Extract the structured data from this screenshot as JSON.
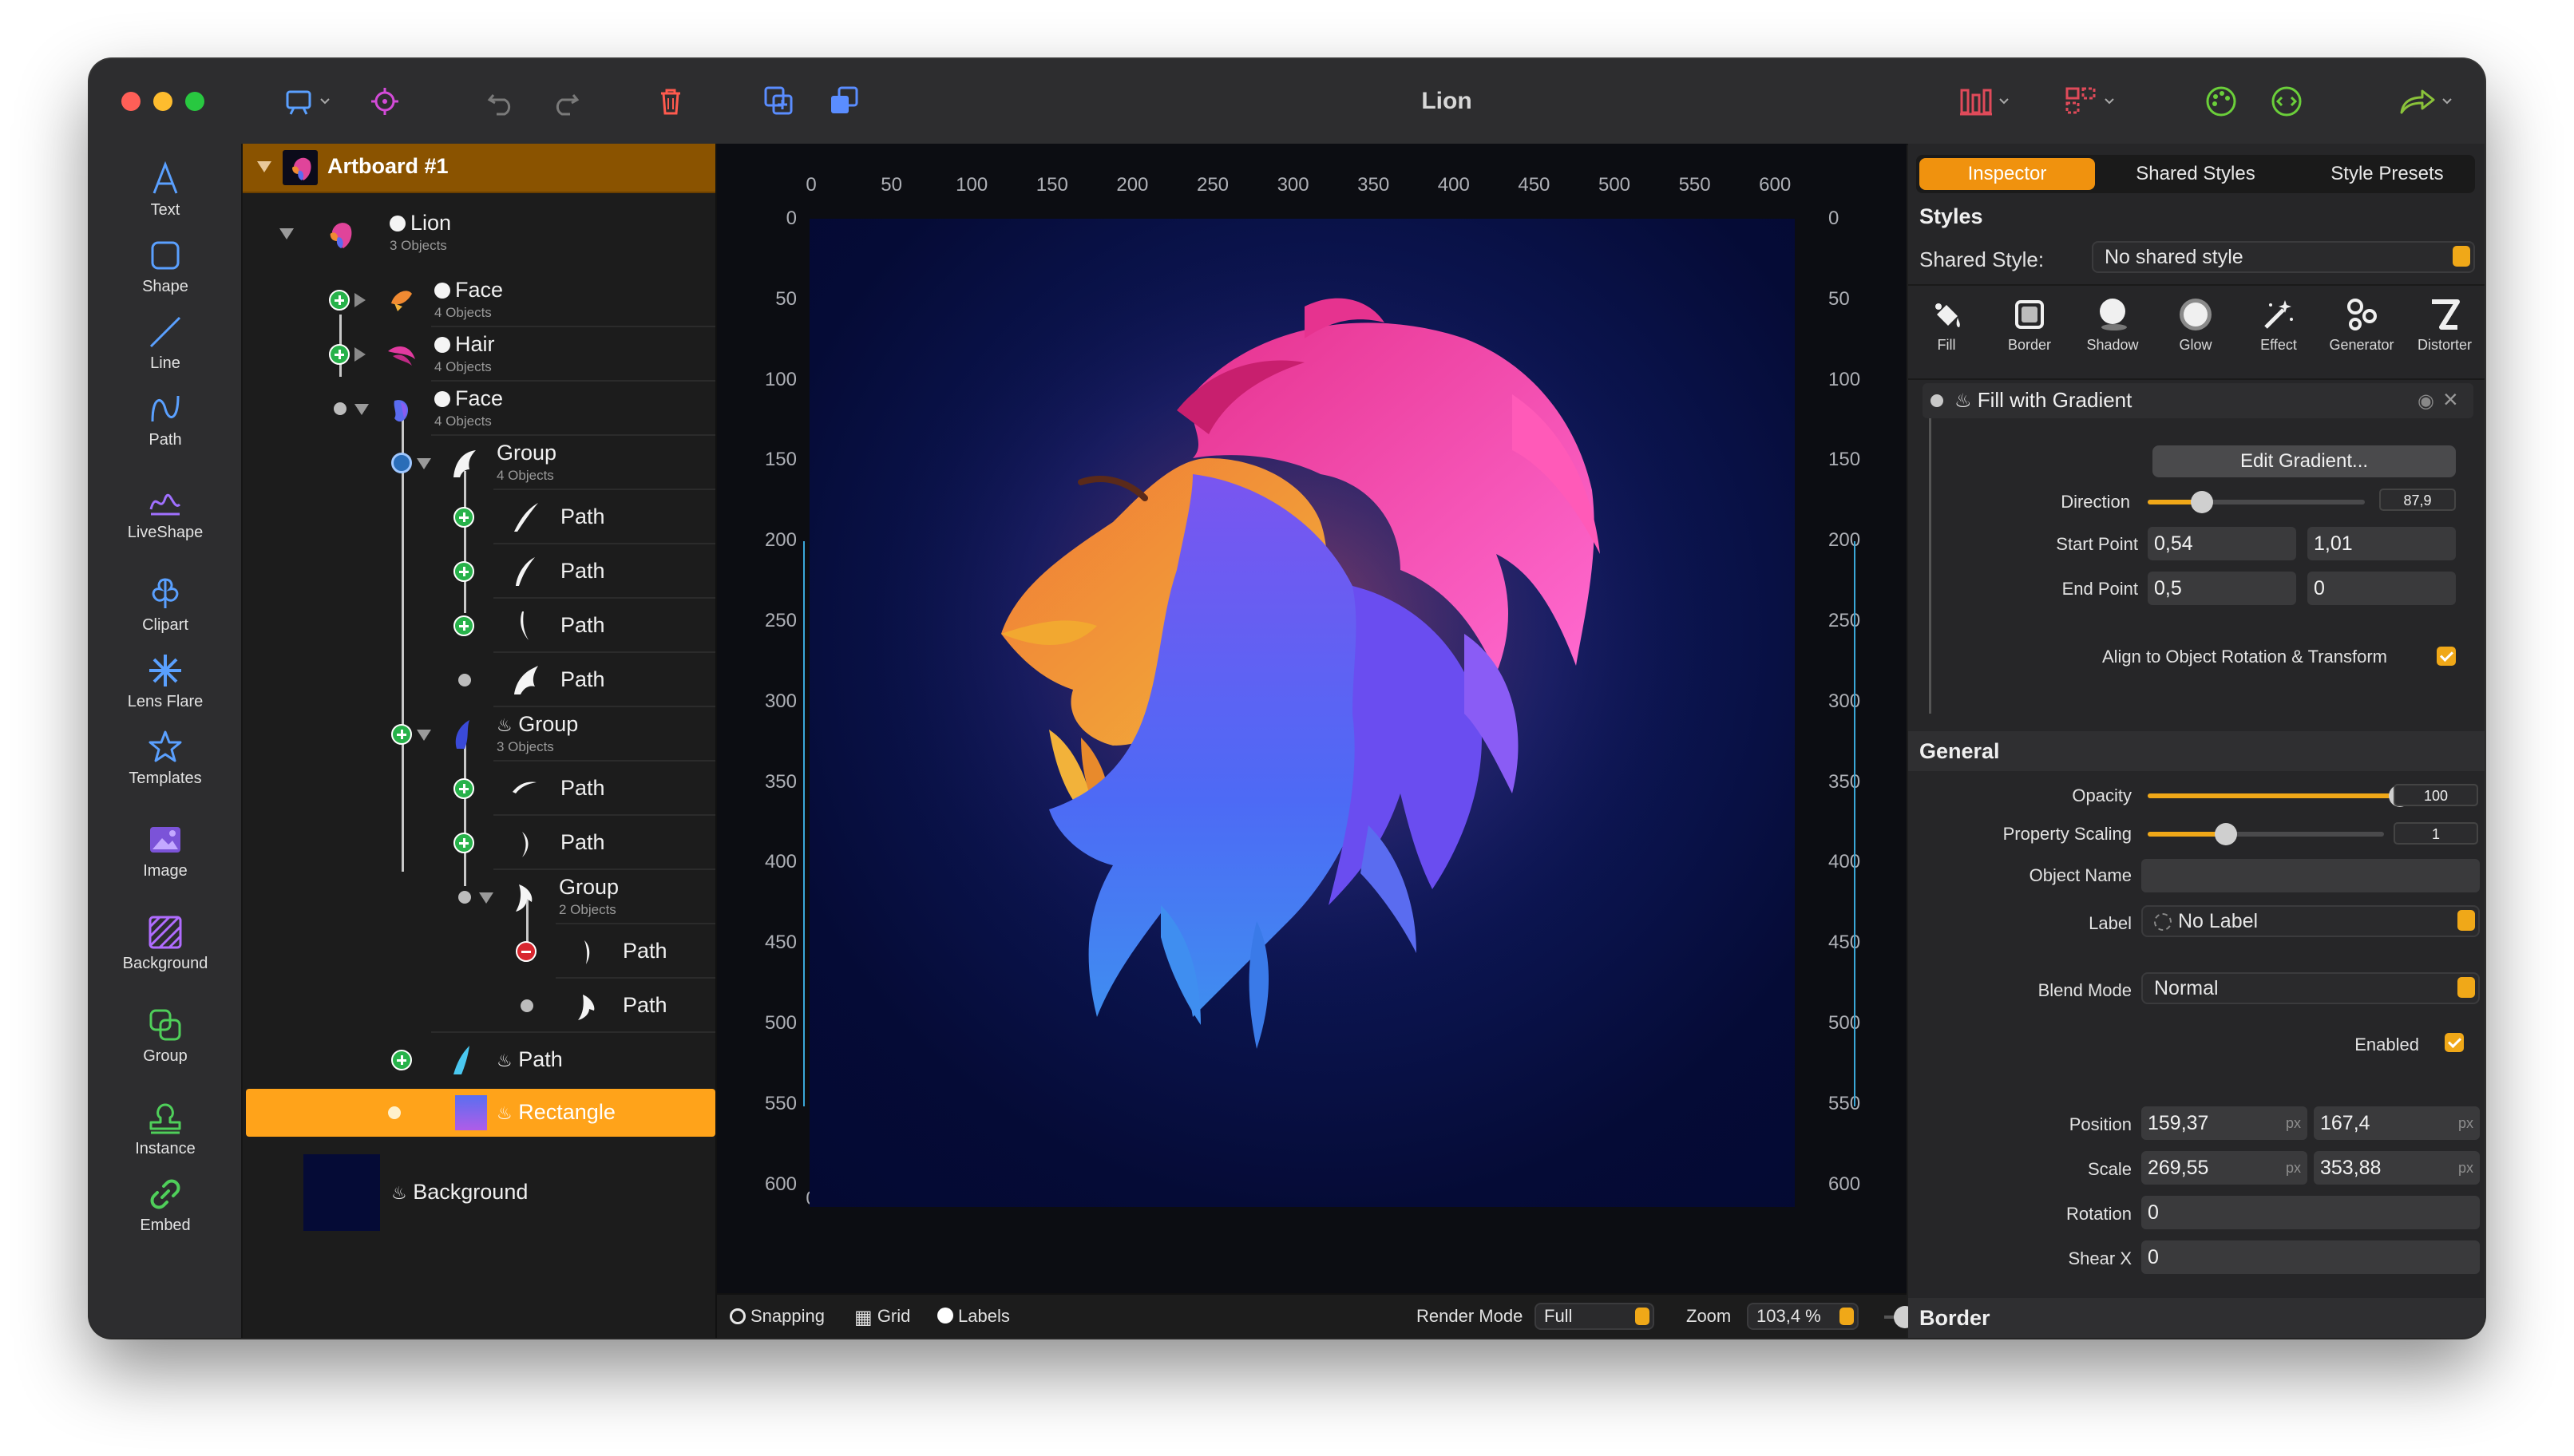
{
  "window": {
    "title": "Lion"
  },
  "tools": [
    {
      "label": "Text",
      "icon": "text-icon"
    },
    {
      "label": "Shape",
      "icon": "shape-icon"
    },
    {
      "label": "Line",
      "icon": "line-icon"
    },
    {
      "label": "Path",
      "icon": "path-icon"
    },
    {
      "label": "LiveShape",
      "icon": "liveshape-icon"
    },
    {
      "label": "Clipart",
      "icon": "clipart-icon"
    },
    {
      "label": "Lens Flare",
      "icon": "lens-flare-icon"
    },
    {
      "label": "Templates",
      "icon": "templates-icon"
    },
    {
      "label": "Image",
      "icon": "image-icon"
    },
    {
      "label": "Background",
      "icon": "background-icon"
    },
    {
      "label": "Group",
      "icon": "group-icon"
    },
    {
      "label": "Instance",
      "icon": "instance-icon"
    },
    {
      "label": "Embed",
      "icon": "embed-icon"
    }
  ],
  "layers": {
    "artboard": "Artboard #1",
    "items": [
      {
        "name": "Lion",
        "sub": "3 Objects"
      },
      {
        "name": "Face",
        "sub": "4 Objects"
      },
      {
        "name": "Hair",
        "sub": "4 Objects"
      },
      {
        "name": "Face",
        "sub": "4 Objects"
      },
      {
        "name": "Group",
        "sub": "4 Objects"
      },
      {
        "name": "Path"
      },
      {
        "name": "Path"
      },
      {
        "name": "Path"
      },
      {
        "name": "Path"
      },
      {
        "name": "Group",
        "sub": "3 Objects"
      },
      {
        "name": "Path"
      },
      {
        "name": "Path"
      },
      {
        "name": "Group",
        "sub": "2 Objects"
      },
      {
        "name": "Path"
      },
      {
        "name": "Path"
      },
      {
        "name": "Path"
      },
      {
        "name": "Rectangle"
      },
      {
        "name": "Background"
      }
    ]
  },
  "canvas": {
    "ruler_labels": [
      "0",
      "50",
      "100",
      "150",
      "200",
      "250",
      "300",
      "350",
      "400",
      "450",
      "500",
      "550",
      "600"
    ]
  },
  "statusbar": {
    "snapping": "Snapping",
    "grid": "Grid",
    "labels": "Labels",
    "render_mode_label": "Render Mode",
    "render_mode_value": "Full",
    "zoom_label": "Zoom",
    "zoom_value": "103,4 %"
  },
  "inspector": {
    "tabs": [
      "Inspector",
      "Shared Styles",
      "Style Presets"
    ],
    "styles_header": "Styles",
    "shared_style_label": "Shared Style:",
    "shared_style_value": "No shared style",
    "style_icons": [
      {
        "label": "Fill",
        "icon": "fill-icon"
      },
      {
        "label": "Border",
        "icon": "border-icon"
      },
      {
        "label": "Shadow",
        "icon": "shadow-icon"
      },
      {
        "label": "Glow",
        "icon": "glow-icon"
      },
      {
        "label": "Effect",
        "icon": "effect-icon"
      },
      {
        "label": "Generator",
        "icon": "generator-icon"
      },
      {
        "label": "Distorter",
        "icon": "distorter-icon"
      }
    ],
    "fill": {
      "title": "Fill with Gradient",
      "edit_button": "Edit Gradient...",
      "direction_label": "Direction",
      "direction_value": "87,9",
      "direction_fraction": 0.25,
      "start_point_label": "Start Point",
      "start_x": "0,54",
      "start_y": "1,01",
      "end_point_label": "End Point",
      "end_x": "0,5",
      "end_y": "0",
      "align_label": "Align to Object Rotation & Transform"
    },
    "general": {
      "header": "General",
      "opacity_label": "Opacity",
      "opacity_value": "100",
      "opacity_fraction": 1.0,
      "scaling_label": "Property Scaling",
      "scaling_value": "1",
      "scaling_fraction": 0.33,
      "object_name_label": "Object Name",
      "object_name_value": "",
      "label_label": "Label",
      "label_value": "No Label",
      "blend_label": "Blend Mode",
      "blend_value": "Normal",
      "enabled_label": "Enabled",
      "position_label": "Position",
      "position_x": "159,37",
      "position_y": "167,4",
      "scale_label": "Scale",
      "scale_x": "269,55",
      "scale_y": "353,88",
      "unit": "px",
      "rotation_label": "Rotation",
      "rotation_value": "0",
      "shear_label": "Shear X",
      "shear_value": "0"
    },
    "border_header": "Border"
  },
  "colors": {
    "accent": "#f0920e",
    "selection": "#ffa31a",
    "artboard_bg": "#050b36"
  }
}
